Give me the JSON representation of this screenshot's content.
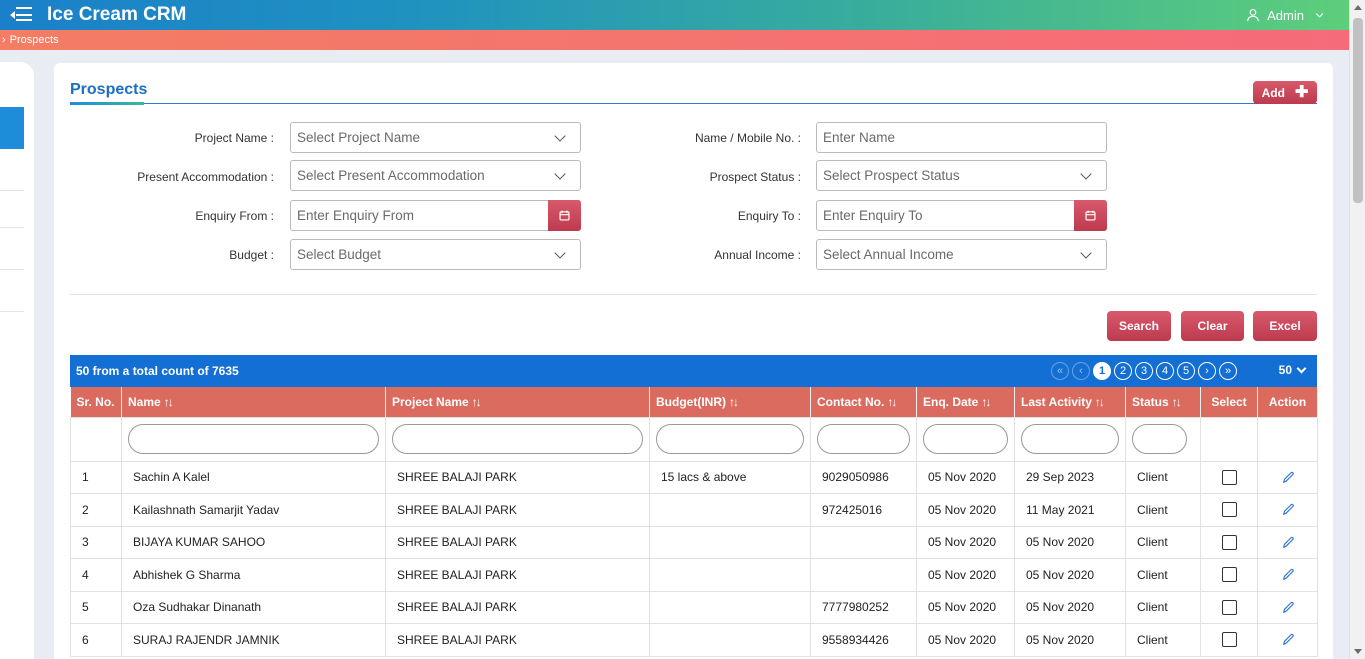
{
  "header": {
    "app_title": "Ice Cream CRM",
    "user_label": "Admin"
  },
  "breadcrumb": {
    "item": "Prospects"
  },
  "page": {
    "title": "Prospects",
    "add_label": "Add"
  },
  "form": {
    "project_name": {
      "label": "Project Name :",
      "placeholder": "Select Project Name"
    },
    "name_mobile": {
      "label": "Name / Mobile No. :",
      "placeholder": "Enter Name"
    },
    "present_accommodation": {
      "label": "Present Accommodation :",
      "placeholder": "Select Present Accommodation"
    },
    "prospect_status": {
      "label": "Prospect Status :",
      "placeholder": "Select Prospect Status"
    },
    "enquiry_from": {
      "label": "Enquiry From :",
      "placeholder": "Enter Enquiry From"
    },
    "enquiry_to": {
      "label": "Enquiry To :",
      "placeholder": "Enter Enquiry To"
    },
    "budget": {
      "label": "Budget :",
      "placeholder": "Select Budget"
    },
    "annual_income": {
      "label": "Annual Income :",
      "placeholder": "Select Annual Income"
    }
  },
  "actions": {
    "search": "Search",
    "clear": "Clear",
    "excel": "Excel"
  },
  "table": {
    "summary": "50 from a total count of 7635",
    "pages": [
      "1",
      "2",
      "3",
      "4",
      "5"
    ],
    "page_size": "50",
    "columns": [
      "Sr. No.",
      "Name",
      "Project Name",
      "Budget(INR)",
      "Contact No.",
      "Enq. Date",
      "Last Activity",
      "Status",
      "Select",
      "Action"
    ],
    "rows": [
      [
        "1",
        "Sachin A Kalel",
        "SHREE BALAJI PARK",
        "15 lacs & above",
        "9029050986",
        "05 Nov 2020",
        "29 Sep 2023",
        "Client"
      ],
      [
        "2",
        "Kailashnath Samarjit Yadav",
        "SHREE BALAJI PARK",
        "",
        "972425016",
        "05 Nov 2020",
        "11 May 2021",
        "Client"
      ],
      [
        "3",
        "BIJAYA KUMAR SAHOO",
        "SHREE BALAJI PARK",
        "",
        "",
        "05 Nov 2020",
        "05 Nov 2020",
        "Client"
      ],
      [
        "4",
        "Abhishek G Sharma",
        "SHREE BALAJI PARK",
        "",
        "",
        "05 Nov 2020",
        "05 Nov 2020",
        "Client"
      ],
      [
        "5",
        "Oza Sudhakar Dinanath",
        "SHREE BALAJI PARK",
        "",
        "7777980252",
        "05 Nov 2020",
        "05 Nov 2020",
        "Client"
      ],
      [
        "6",
        "SURAJ RAJENDR JAMNIK",
        "SHREE BALAJI PARK",
        "",
        "9558934426",
        "05 Nov 2020",
        "05 Nov 2020",
        "Client"
      ]
    ]
  },
  "colors": {
    "brand_blue": "#136fd3",
    "accent_red": "#c9475a",
    "header_salmon": "#db6b5e"
  }
}
